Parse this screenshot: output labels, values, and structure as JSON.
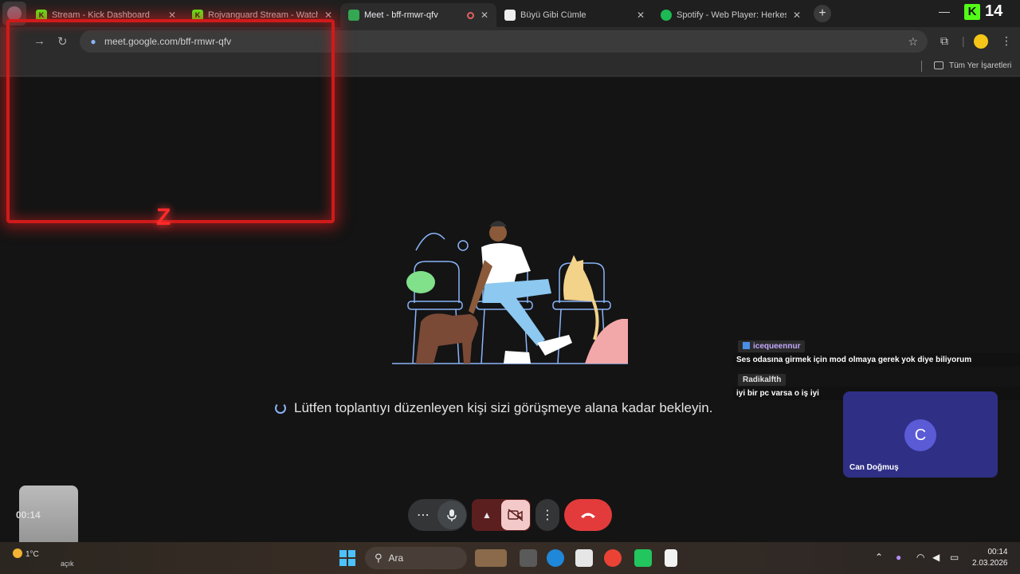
{
  "browser": {
    "tabs": [
      {
        "title": "Stream - Kick Dashboard",
        "favicon": "kick-icon",
        "color": "#53fc18"
      },
      {
        "title": "Rojvanguard Stream - Watch L",
        "favicon": "kick-icon",
        "color": "#53fc18"
      },
      {
        "title": "Meet - bff-rmwr-qfv",
        "favicon": "meet-icon",
        "color": "#34a853",
        "active": true
      },
      {
        "title": "Büyü Gibi Cümle",
        "favicon": "chatgpt-icon",
        "color": "#ffffff"
      },
      {
        "title": "Spotify - Web Player: Herkes iç",
        "favicon": "spotify-icon",
        "color": "#1db954"
      }
    ],
    "kick_count": "14",
    "url": "meet.google.com/bff-rmwr-qfv",
    "bookmarks_label": "Tüm Yer İşaretleri"
  },
  "meet": {
    "waiting_text": "Lütfen toplantıyı düzenleyen kişi sizi görüşmeye alana kadar bekleyin.",
    "self_initial": "C",
    "self_name": "Can Doğmuş"
  },
  "chat": [
    {
      "user": "icequeennur",
      "message": "Ses odasına girmek için mod olmaya gerek yok diye biliyorum"
    },
    {
      "user": "Radikalfth",
      "message": "iyi bir pc varsa o iş iyi"
    }
  ],
  "timer": "00:14",
  "taskbar": {
    "weather_temp": "1°C",
    "weather_desc": "açık",
    "search_placeholder": "Ara",
    "time": "00:14",
    "date": "2.03.2026"
  },
  "colors": {
    "end_call": "#e33b3b",
    "cam_off_bg": "#5c1f1f",
    "self_tile": "#2f2f86",
    "kick_green": "#53fc18"
  }
}
